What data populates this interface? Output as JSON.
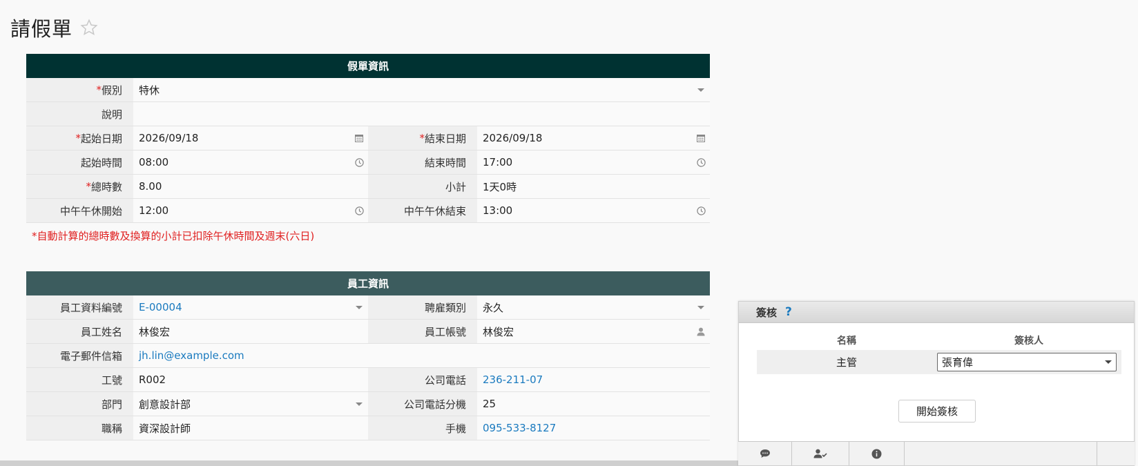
{
  "page": {
    "title": "請假單"
  },
  "leave_section": {
    "header": "假單資訊",
    "leave_type": {
      "label": "假別",
      "value": "特休"
    },
    "description": {
      "label": "說明",
      "value": ""
    },
    "start_date": {
      "label": "起始日期",
      "value": "2026/09/18"
    },
    "end_date": {
      "label": "結束日期",
      "value": "2026/09/18"
    },
    "start_time": {
      "label": "起始時間",
      "value": "08:00"
    },
    "end_time": {
      "label": "結束時間",
      "value": "17:00"
    },
    "total_hours": {
      "label": "總時數",
      "value": "8.00"
    },
    "subtotal": {
      "label": "小計",
      "value": "1天0時"
    },
    "lunch_start": {
      "label": "中午午休開始",
      "value": "12:00"
    },
    "lunch_end": {
      "label": "中午午休結束",
      "value": "13:00"
    },
    "note": "*自動計算的總時數及換算的小計已扣除午休時間及週末(六日)"
  },
  "employee_section": {
    "header": "員工資訊",
    "employee_id": {
      "label": "員工資料編號",
      "value": "E-00004"
    },
    "employment_type": {
      "label": "聘雇類別",
      "value": "永久"
    },
    "name": {
      "label": "員工姓名",
      "value": "林俊宏"
    },
    "account": {
      "label": "員工帳號",
      "value": "林俊宏"
    },
    "email": {
      "label": "電子郵件信箱",
      "value": "jh.lin@example.com"
    },
    "staff_no": {
      "label": "工號",
      "value": "R002"
    },
    "office_phone": {
      "label": "公司電話",
      "value": "236-211-07"
    },
    "department": {
      "label": "部門",
      "value": "創意設計部"
    },
    "extension": {
      "label": "公司電話分機",
      "value": "25"
    },
    "job_title": {
      "label": "職稱",
      "value": "資深設計師"
    },
    "mobile": {
      "label": "手機",
      "value": "095-533-8127"
    }
  },
  "approval": {
    "title": "簽核",
    "help": "?",
    "col_name": "名稱",
    "col_approver": "簽核人",
    "rows": [
      {
        "role": "主管",
        "approver": "張育偉"
      }
    ],
    "start_button": "開始簽核",
    "toolbar_icons": [
      "comment-icon",
      "user-check-icon",
      "info-icon"
    ]
  },
  "colors": {
    "leave_header": "#003232",
    "employee_header": "#3c5c5e",
    "required": "#e02020",
    "link": "#1a7abf"
  }
}
